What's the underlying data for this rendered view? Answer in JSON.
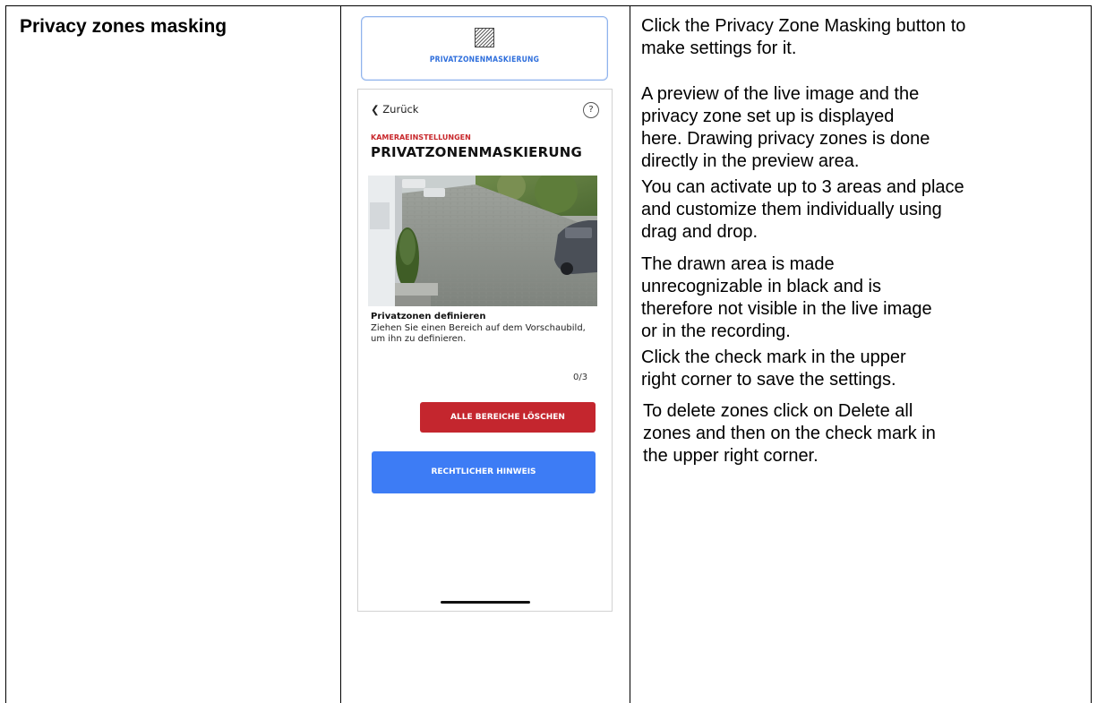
{
  "feature_title": "Privacy zones masking",
  "app_button": {
    "icon": "privacy-mask-icon",
    "label": "PRIVATZONENMASKIERUNG"
  },
  "phone": {
    "back_label": "Zurück",
    "help_icon": "?",
    "section": "KAMERAEINSTELLUNGEN",
    "title": "PRIVATZONENMASKIERUNG",
    "define_title": "Privatzonen definieren",
    "define_desc": "Ziehen Sie einen Bereich auf dem Vorschaubild, um ihn zu definieren.",
    "counter": "0/3",
    "delete_all_button": "ALLE BEREICHE LÖSCHEN",
    "legal_button": "RECHTLICHER HINWEIS",
    "colors": {
      "accent_red": "#c4262e",
      "accent_blue": "#3d7cf5"
    }
  },
  "instructions": {
    "p1": [
      "Click the Privacy Zone Masking button to",
      "make settings for it."
    ],
    "p2": [
      "A preview of the live image and the",
      "privacy zone set up is displayed",
      "here. Drawing privacy zones is done",
      "directly in the preview area."
    ],
    "p3": [
      "You can activate up to 3 areas and place",
      "and customize them individually using",
      "drag and drop."
    ],
    "p4": [
      "The drawn area is made",
      "unrecognizable in black and is",
      "therefore not visible in the live image",
      "or in the recording."
    ],
    "p5": [
      "Click the check mark in the upper",
      "right corner to save the settings."
    ],
    "p6": [
      "To delete zones click on Delete all",
      "zones and then on the check mark in",
      "the upper right corner."
    ]
  }
}
